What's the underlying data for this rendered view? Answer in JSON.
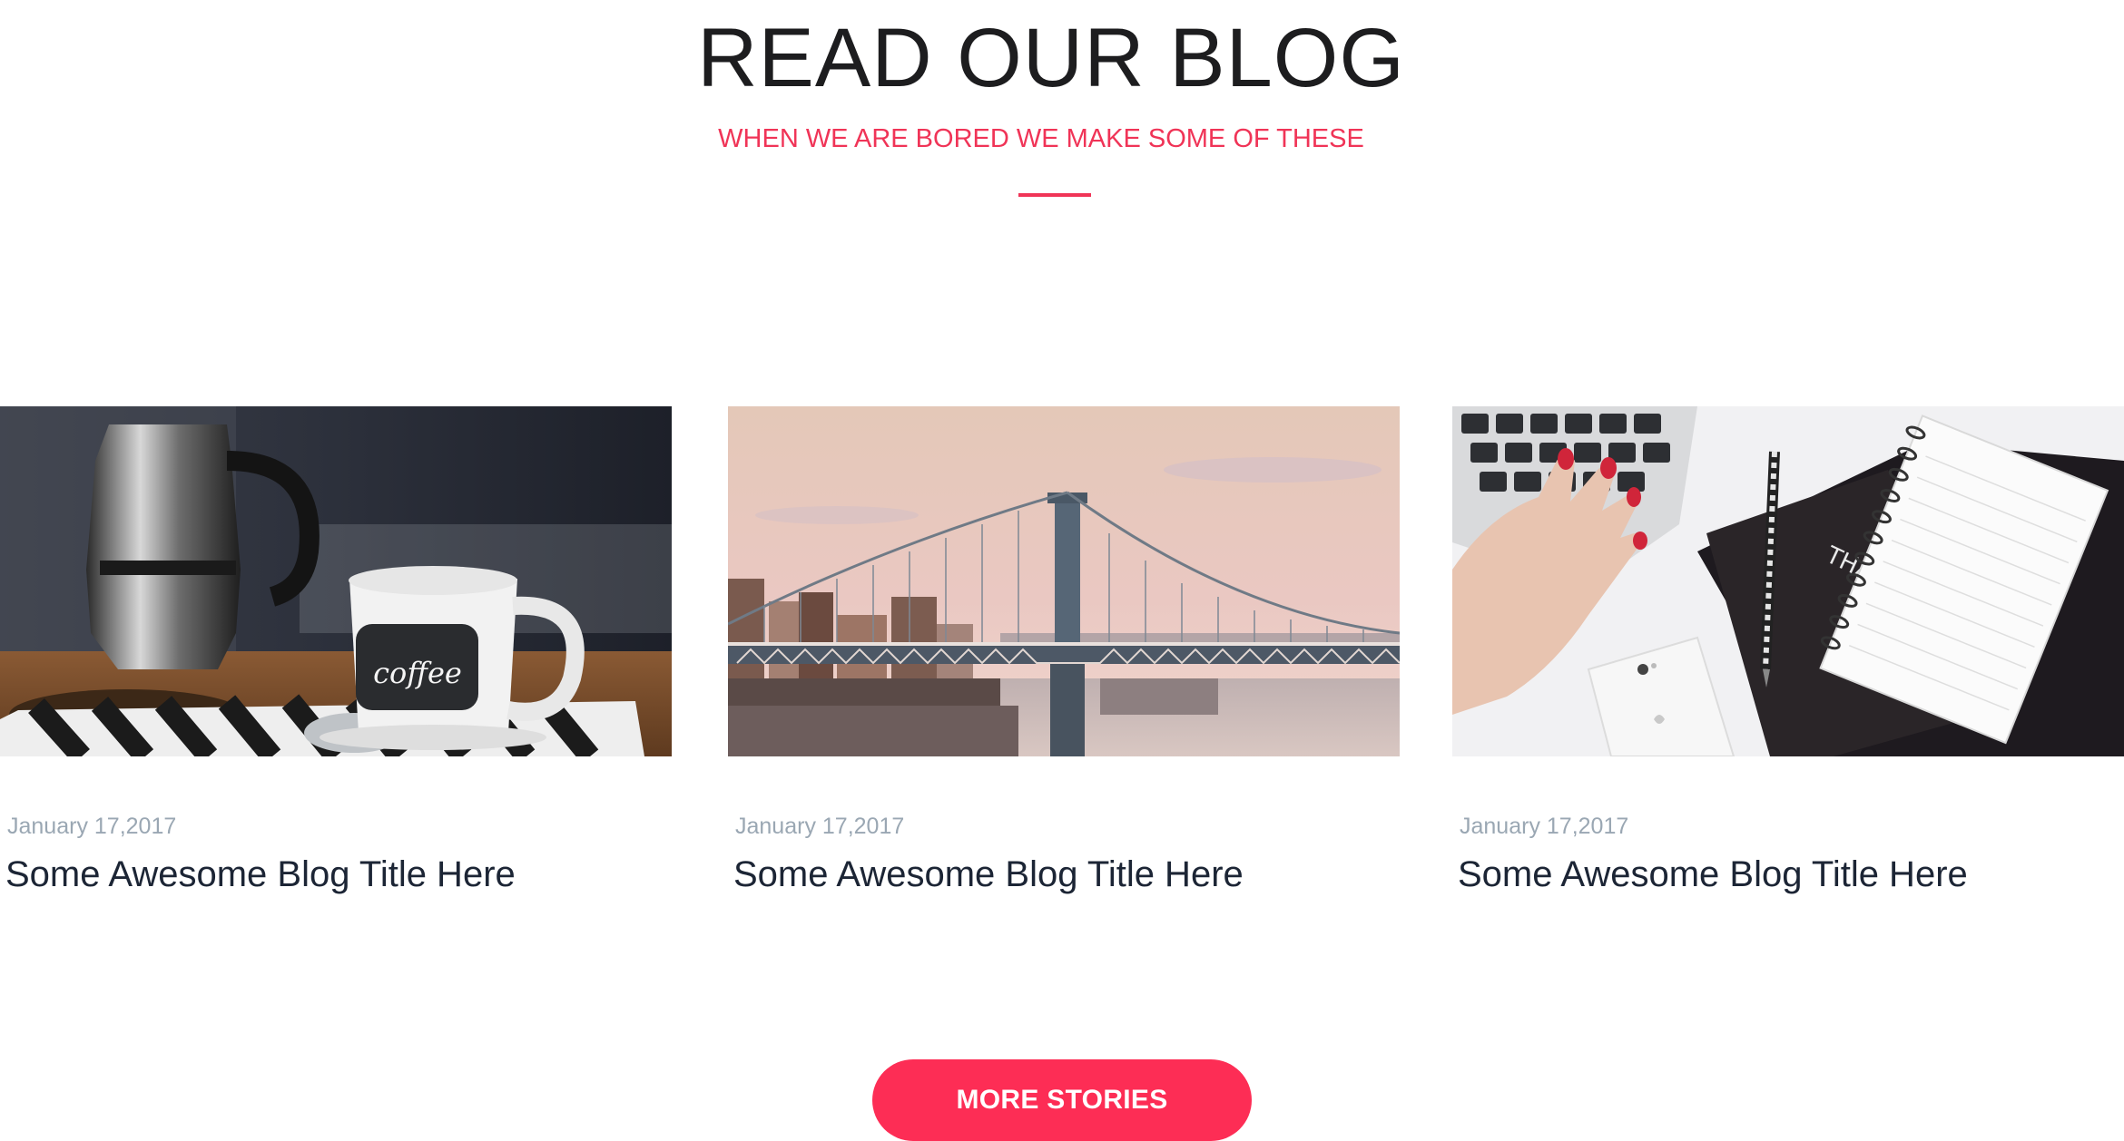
{
  "header": {
    "title": "READ OUR BLOG",
    "subtitle": "WHEN WE ARE BORED WE MAKE SOME OF THESE"
  },
  "posts": [
    {
      "date": "January 17,2017",
      "title": "Some Awesome Blog Title Here",
      "image": "coffee-cup-image",
      "mug_text": "coffee"
    },
    {
      "date": "January 17,2017",
      "title": "Some Awesome Blog Title Here",
      "image": "bridge-city-image"
    },
    {
      "date": "January 17,2017",
      "title": "Some Awesome Blog Title Here",
      "image": "laptop-notebook-image"
    }
  ],
  "more_button": {
    "label": "MORE STORIES"
  },
  "colors": {
    "accent": "#f03457",
    "button": "#fd2d55",
    "title_text": "#1c2535",
    "date_text": "#9aa7b3"
  }
}
